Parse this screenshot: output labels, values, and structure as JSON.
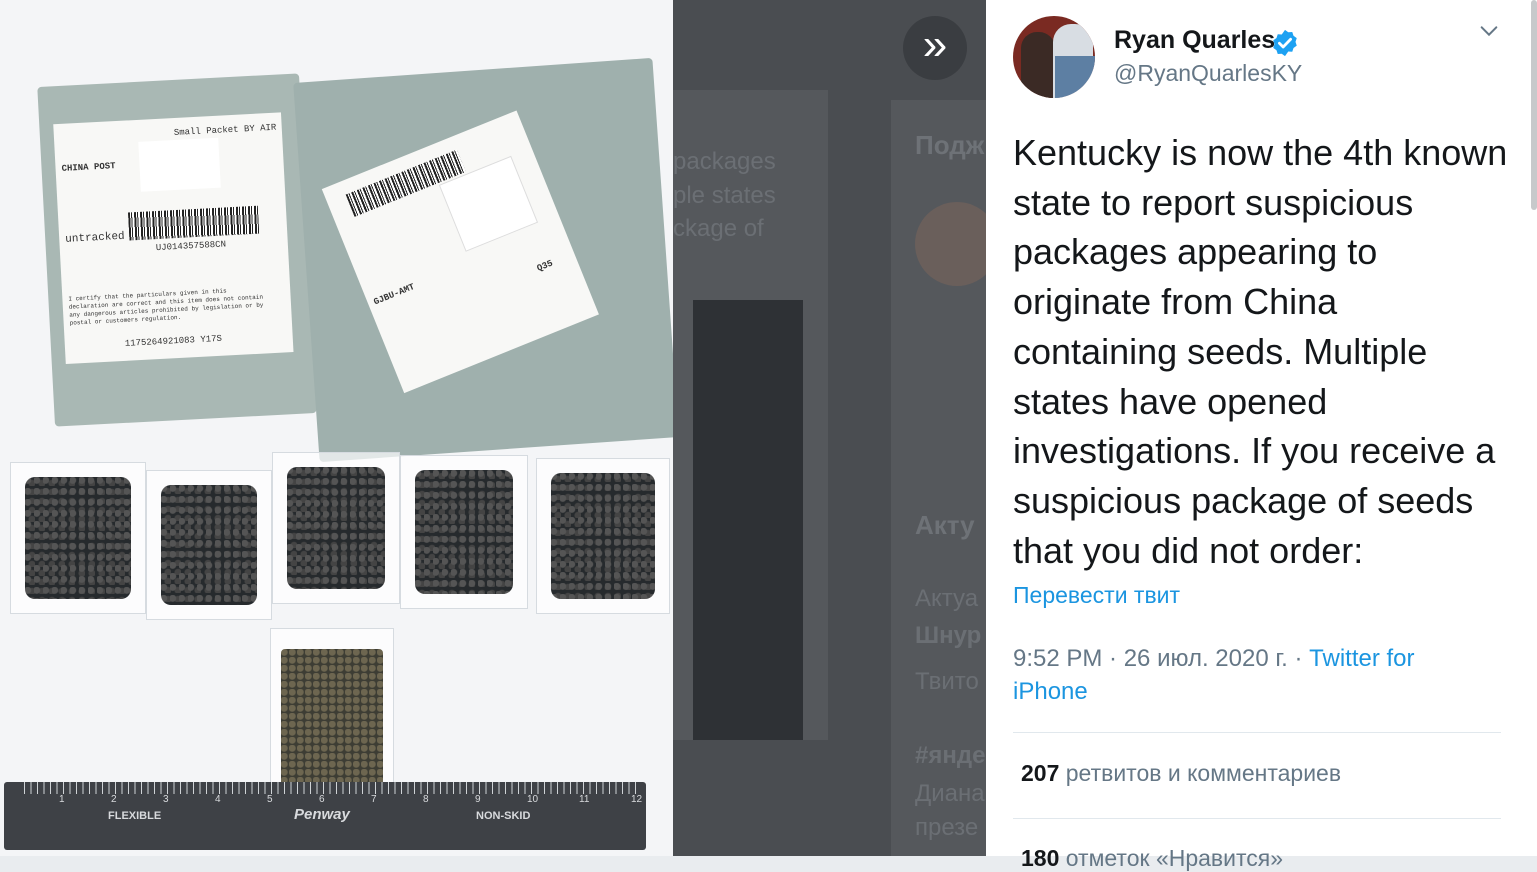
{
  "photo": {
    "caption_labels": {
      "carrier": "CHINA POST",
      "small_packet": "Small Packet BY AIR",
      "untracked": "untracked",
      "tracking_1": "UJ014357588CN",
      "code_1": "1175264921083 Y17S",
      "code_2": "GJBU-AMT",
      "code_3": "Q35",
      "declaration": "I certify that the particulars given in this declaration are correct and this item does not contain any dangerous articles prohibited by legislation or by postal or customers regulation."
    },
    "ruler": {
      "brand": "Penway",
      "left_word": "FLEXIBLE",
      "right_word": "NON-SKID",
      "inch_marks": [
        "1",
        "2",
        "3",
        "4",
        "5",
        "6",
        "7",
        "8",
        "9",
        "10",
        "11",
        "12"
      ]
    }
  },
  "background": {
    "fragments": [
      "packages",
      "ple states",
      "ckage of"
    ],
    "headings": [
      "Подж",
      "Акту"
    ],
    "side_texts": [
      "Актуа",
      "Шнур",
      "Твито",
      "#янде",
      "Диана",
      "презе"
    ]
  },
  "tweet": {
    "display_name": "Ryan Quarles",
    "handle": "@RyanQuarlesKY",
    "verified": true,
    "text": "Kentucky is now the 4th known state to report suspicious packages appearing to originate from China containing seeds. Multiple states have opened investigations. If you receive a suspicious package of seeds that you did not order:",
    "translate_label": "Перевести твит",
    "time_date": "9:52 PM · 26 июл. 2020 г. · ",
    "source": "Twitter for iPhone",
    "retweets_count": "207",
    "retweets_label": "ретвитов и комментариев",
    "likes_count": "180",
    "likes_label": "отметок «Нравится»",
    "colors": {
      "link": "#1b95e0",
      "verified": "#1da1f2",
      "text": "#14171a",
      "muted": "#657786"
    }
  }
}
